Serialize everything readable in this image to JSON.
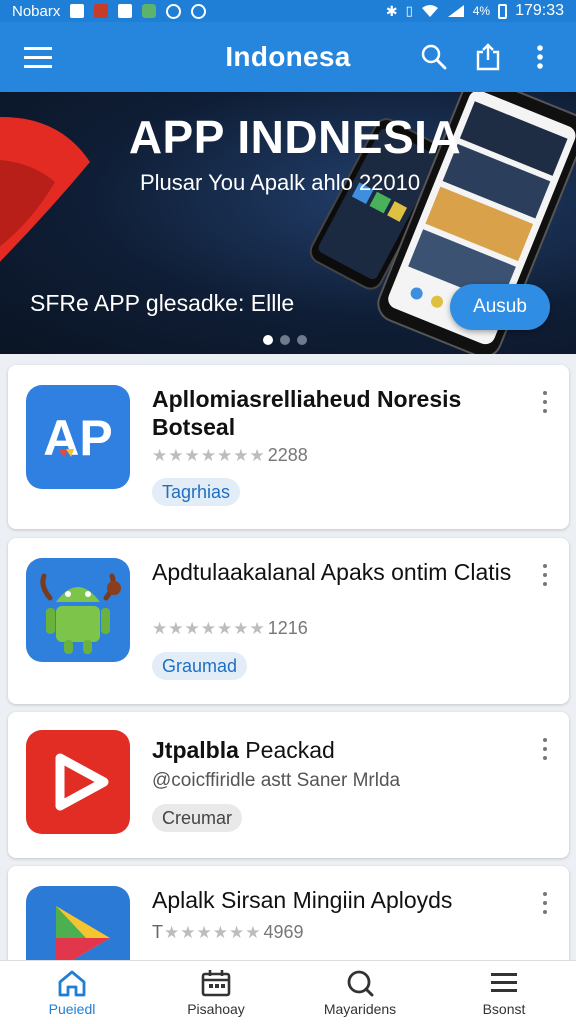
{
  "status_bar": {
    "carrier": "Nobarx",
    "battery": "4%",
    "time": "179:33"
  },
  "app_bar": {
    "title": "Indonesa",
    "icons": [
      "menu-icon",
      "search-icon",
      "share-icon",
      "more-vert-icon"
    ]
  },
  "banner": {
    "headline": "APP INDNESIA",
    "subheadline": "Plusar You Apalk ahlo 22010",
    "tagline": "SFRe APP glesadke: Ellle",
    "cta_label": "Ausub",
    "slide_count": 3,
    "active_slide": 1
  },
  "apps": [
    {
      "name": "Apllomiasrelliaheud Noresis Botseal",
      "bold": true,
      "rating_count": "2288",
      "subtitle": "",
      "chip": "Tagrhias",
      "chip_style": "blue",
      "icon": "ap-logo-icon",
      "icon_text": "AP"
    },
    {
      "name": "Apdtulaakalanal Apaks ontim Clatis",
      "bold": false,
      "rating_count": "1216",
      "subtitle": "",
      "chip": "Graumad",
      "chip_style": "blue",
      "icon": "android-robot-icon"
    },
    {
      "name_bold_part": "Jtpalbla",
      "name_rest": " Peackad",
      "subtitle": "@coicffiridle astt Saner Mrlda",
      "chip": "Creumar",
      "chip_style": "grey",
      "icon": "play-button-icon"
    },
    {
      "name": "Aplalk Sirsan Mingiin Aployds",
      "bold": false,
      "rating_count": "4969",
      "rating_prefix": "T",
      "icon": "play-store-triangle-icon"
    }
  ],
  "bottom_nav": [
    {
      "label": "Pueiedl",
      "icon": "home-icon",
      "active": true
    },
    {
      "label": "Pisahoay",
      "icon": "calendar-icon",
      "active": false
    },
    {
      "label": "Mayaridens",
      "icon": "search-circle-icon",
      "active": false
    },
    {
      "label": "Bsonst",
      "icon": "menu-lines-icon",
      "active": false
    }
  ],
  "colors": {
    "primary": "#2686de",
    "status_bar": "#1f7fd6",
    "chip_blue_bg": "#e3edf8",
    "chip_blue_text": "#1f6fc0"
  }
}
